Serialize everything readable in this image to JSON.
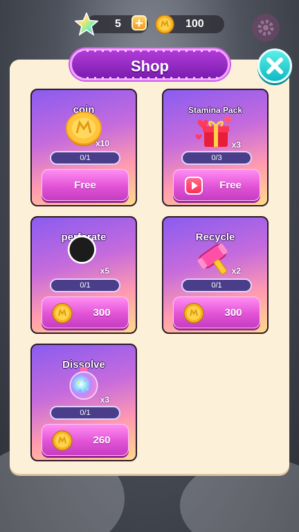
{
  "top_bar": {
    "stars": "5",
    "coins": "100",
    "icons": [
      "rainbow-star-icon",
      "plus-icon",
      "gold-coin-icon",
      "gear-icon"
    ]
  },
  "panel": {
    "title": "Shop",
    "close_icon": "close-x-icon"
  },
  "items": [
    {
      "name": "coin",
      "icon": "gold-coin-icon",
      "multiplier": "x10",
      "progress": "0/1",
      "progress_fraction": 0,
      "price": "Free",
      "price_type": "free"
    },
    {
      "name": "Stamina Pack",
      "icon": "gift-hearts-icon",
      "multiplier": "x3",
      "progress": "0/3",
      "progress_fraction": 0,
      "price": "Free",
      "price_type": "video"
    },
    {
      "name": "perforate",
      "icon": "hole-icon",
      "multiplier": "x5",
      "progress": "0/1",
      "progress_fraction": 0,
      "price": "300",
      "price_type": "coin"
    },
    {
      "name": "Recycle",
      "icon": "hammer-icon",
      "multiplier": "x2",
      "progress": "0/1",
      "progress_fraction": 0,
      "price": "300",
      "price_type": "coin"
    },
    {
      "name": "Dissolve",
      "icon": "potion-icon",
      "multiplier": "x3",
      "progress": "0/1",
      "progress_fraction": 0,
      "price": "260",
      "price_type": "coin"
    }
  ],
  "colors": {
    "panel_bg": "#fdf0d8",
    "title_banner": "#9a2ac8",
    "close_button": "#2fd6d8",
    "buy_button": "#e253d6"
  }
}
